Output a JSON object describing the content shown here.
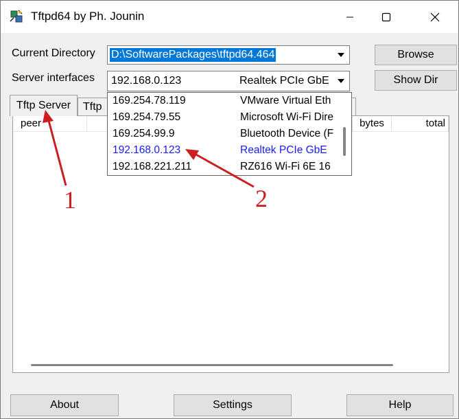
{
  "window": {
    "title": "Tftpd64 by Ph. Jounin"
  },
  "form": {
    "current_directory_label": "Current Directory",
    "current_directory_value": "D:\\SoftwarePackages\\tftpd64.464",
    "server_interfaces_label": "Server interfaces",
    "server_interface_ip": "192.168.0.123",
    "server_interface_device": "Realtek PCIe GbE"
  },
  "buttons": {
    "browse": "Browse",
    "show_dir": "Show Dir",
    "about": "About",
    "settings": "Settings",
    "help": "Help"
  },
  "tabs": {
    "tftp_server": "Tftp Server",
    "tftp_client_partial": "Tftp"
  },
  "table": {
    "columns": [
      "peer",
      "bytes",
      "total"
    ]
  },
  "dropdown": {
    "items": [
      {
        "ip": "169.254.78.119",
        "device": "VMware Virtual Eth"
      },
      {
        "ip": "169.254.79.55",
        "device": "Microsoft Wi-Fi Dire"
      },
      {
        "ip": "169.254.99.9",
        "device": "Bluetooth Device (F"
      },
      {
        "ip": "192.168.0.123",
        "device": "Realtek PCIe GbE"
      },
      {
        "ip": "192.168.221.211",
        "device": "RZ616 Wi-Fi 6E 16"
      }
    ],
    "selected_index": 3
  },
  "annotations": {
    "label_1": "1",
    "label_2": "2",
    "color": "#cc1e1e"
  },
  "colors": {
    "selection_bg": "#0078d7",
    "selected_item_text": "#1a1aff"
  }
}
